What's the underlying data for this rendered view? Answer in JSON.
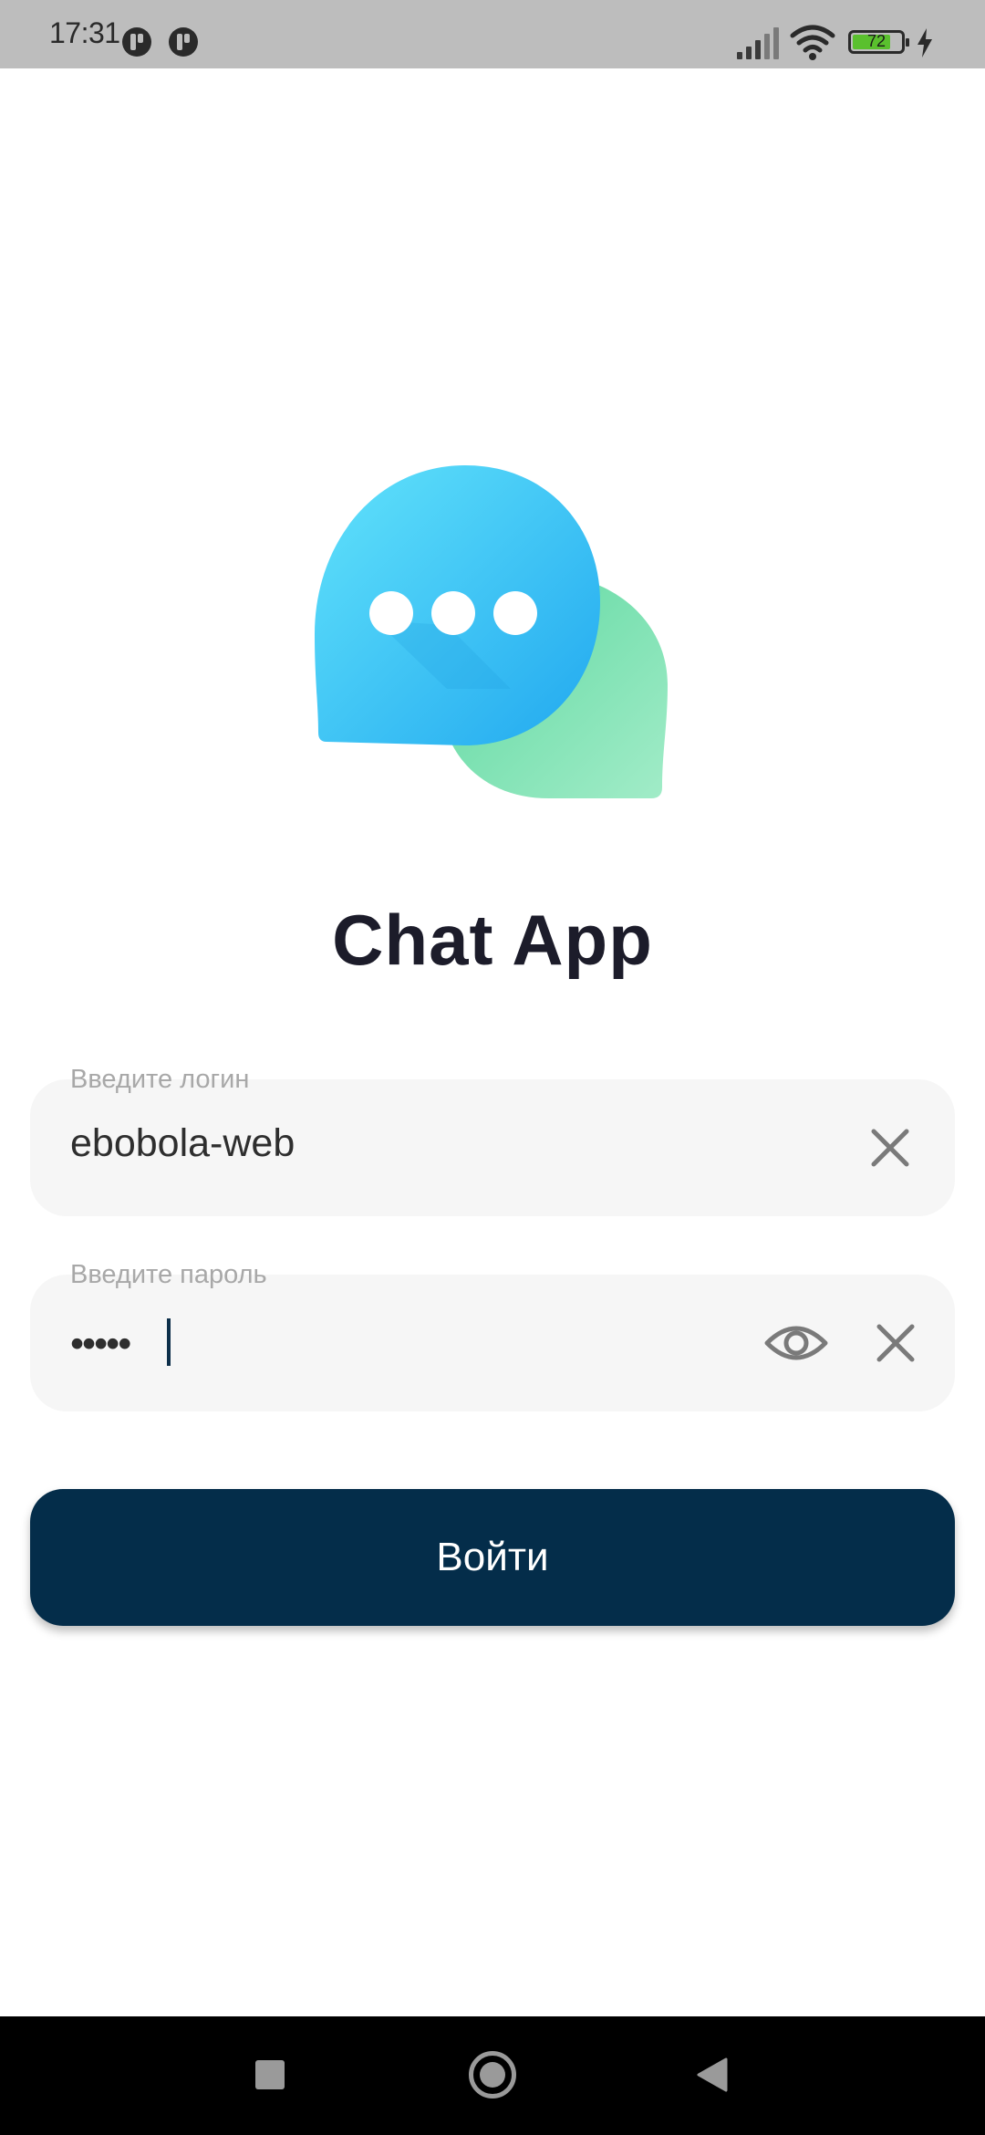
{
  "status_bar": {
    "time": "17:31",
    "battery_level": "72",
    "icons": [
      "app-notification-icon",
      "app-notification-icon",
      "signal-icon",
      "wifi-icon",
      "battery-icon",
      "charging-icon"
    ]
  },
  "app": {
    "title": "Chat App",
    "logo_icon": "chat-bubbles-logo",
    "colors": {
      "bubble_blue": "#4ecdf8",
      "bubble_green": "#6fdca8",
      "button": "#042d4a",
      "title": "#1c1c2a"
    }
  },
  "login_field": {
    "label": "Введите логин",
    "value": "ebobola-web",
    "clear_icon": "close-icon"
  },
  "password_field": {
    "label": "Введите пароль",
    "value": "•••••",
    "visibility_icon": "eye-icon",
    "clear_icon": "close-icon"
  },
  "login_button": {
    "label": "Войти"
  },
  "nav_bar": {
    "icons": [
      "recents-square-icon",
      "home-circle-icon",
      "back-triangle-icon"
    ]
  }
}
